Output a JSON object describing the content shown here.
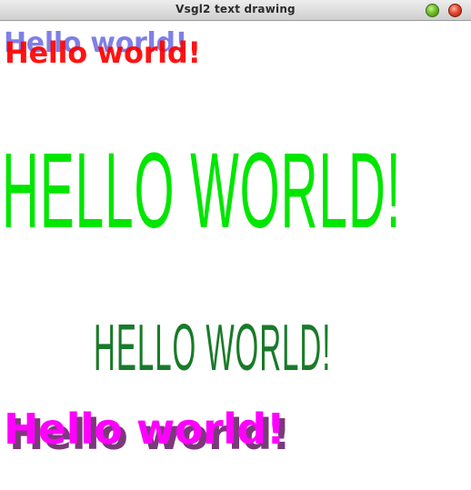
{
  "window": {
    "title": "Vsgl2 text drawing"
  },
  "texts": {
    "line1_shadow": "Hello world!",
    "line1": "Hello world!",
    "line2": "HELLO WORLD!",
    "line3": "HELLO WORLD!",
    "line4_shadow": "Hello world!",
    "line4": "Hello world!"
  },
  "colors": {
    "line1_shadow": "#7f7fe6",
    "line1": "#ff0000",
    "line2": "#00e600",
    "line3": "#1a7a2a",
    "line4_shadow": "#7a3a7a",
    "line4": "#ff00ff"
  },
  "icons": {
    "minimize": "green-ball-icon",
    "close": "red-ball-icon"
  }
}
